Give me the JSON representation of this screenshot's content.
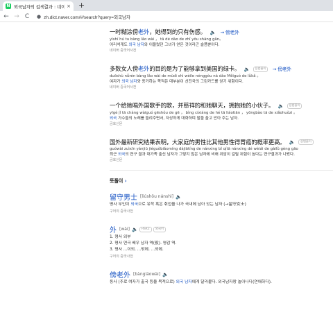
{
  "browser": {
    "tab_title": "외국남자의 검색결과 : 네이버",
    "tab_close": "×",
    "new_tab": "+",
    "back": "←",
    "forward": "→",
    "reload": "C",
    "url": "zh.dict.naver.com/#/search?query=외국남자"
  },
  "examples": [
    {
      "zh_pre": "一时糊涂傍",
      "zh_hl": "老外",
      "zh_post": "，她得到的只有伤感。",
      "pinyin": "yìshí hú tu bàng lǎo wài ， tā dé dào de zhǐ yǒu shāng gǎn。",
      "ko_pre": "어리석게도 ",
      "ko_hl": "외국 남자",
      "ko_post": "와 어울렸던 그녀가 얻은 것이라곤 슬픔뿐이다.",
      "src": "네이버 중국어사전",
      "link": "→ 傍老外",
      "badge": ""
    },
    {
      "zh_pre": "多数女人傍",
      "zh_hl": "老外",
      "zh_post": "的目的是为了能够拿到美国的绿卡。",
      "pinyin": "duōshù nǚrén bàng lǎo wài de mùdì shì wèile nénggòu ná dào Měiguó de lǜkǎ 。",
      "ko_pre": "여자가 ",
      "ko_hl": "외국 남자",
      "ko_post": "와 동거하는 목적은 대부분이 선진국의 그린카드를 얻기 위함이다.",
      "src": "네이버 중국어사전",
      "link": "→ 傍老外",
      "badge": "용법풀이"
    },
    {
      "zh_pre": "一个给她唱外国歌手的歌，并慈祥的和她聊天，拥抱她的小伙子。",
      "zh_hl": "",
      "zh_post": "",
      "pinyin": "yīgè jǐ tā chàng wàiguó gēshǒu de gē ， bìng cíxiáng de hé tā liáotiān ， yōngbào tā de xiǎohuǒzi 。",
      "ko_pre": "",
      "ko_hl": "외국",
      "ko_post": " 가수들의 노래를 들려주면서, 자상하게 대화하며 팔을 끌고 안아 주는 남자.",
      "src": "금호신문",
      "link": "",
      "badge": "용법풀이"
    },
    {
      "zh_pre": "国外最新研究结果表明，大家庭的男性比其他男性得胃癌的概率更高。",
      "zh_hl": "",
      "zh_post": "",
      "pinyin": "guówài zuìxīn yánjiū jiéguǒbiǎomíng dàjiātíng de nánxìng bǐ qítā nánxìng dé wèiái de gàilǜ gèng gāo",
      "ko_pre": "최근 ",
      "ko_hl": "외국",
      "ko_post": "의 연구 결과 대가족 출신 남자가 그렇지 않은 남자에 비해 위암이 걸릴 위험이 높다는 연구결과가 나왔다.",
      "src": "금호신문",
      "link": "",
      "badge": "용법풀이"
    }
  ],
  "section": {
    "title": "뜻풀이",
    "arrow": "›"
  },
  "entries": [
    {
      "word": "留守男士",
      "pinyin": "[liúshǒu nánshì]",
      "def_pre": "명사 부인이 ",
      "def_hl": "외국",
      "def_post": "으로 유학 혹은 취업을 나가 국내에 남아 있는 남자 (→留守女士)",
      "src": "구어의 중국사전"
    },
    {
      "word": "外",
      "pinyin": "[wài]",
      "def_pre": "1. 명사 외부",
      "def_hl": "",
      "def_post": "",
      "def2": "2. 명사 연극 배우 남자 역(役). 영감 역.",
      "def3": "3. 명사 ...이외. ...밖에. ...외에.",
      "src": "구어의 중국사전",
      "badges": [
        "HSK2",
        "외국어"
      ]
    },
    {
      "word": "傍老外",
      "pinyin": "[bàngláowài]",
      "def_pre": "동사 (주로 여자가 출국 등을 목적으로) ",
      "def_hl": "외국 남자",
      "def_post": "에게 달라붙다. 외국남자랑 놀아나다(연애하다).",
      "src": ""
    }
  ]
}
